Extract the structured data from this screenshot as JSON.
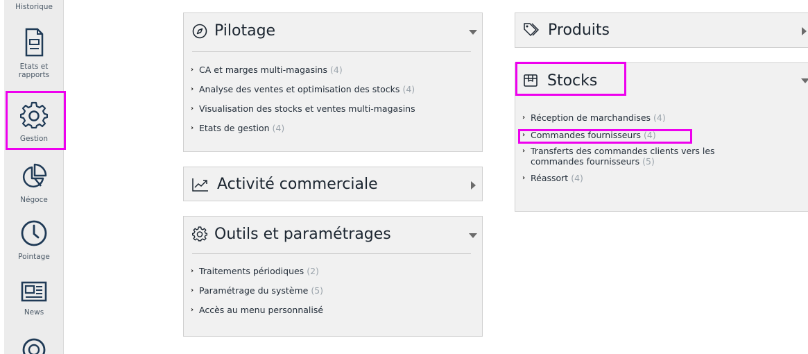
{
  "sidebar": {
    "items": [
      {
        "label": "Historique"
      },
      {
        "label": "Etats et\nrapports"
      },
      {
        "label": "Gestion"
      },
      {
        "label": "Négoce"
      },
      {
        "label": "Pointage"
      },
      {
        "label": "News"
      }
    ]
  },
  "panels": {
    "pilotage": {
      "title": "Pilotage",
      "items": [
        {
          "label": "CA et marges multi-magasins",
          "count": "(4)"
        },
        {
          "label": "Analyse des ventes et optimisation des stocks",
          "count": "(4)"
        },
        {
          "label": "Visualisation des stocks et ventes multi-magasins",
          "count": ""
        },
        {
          "label": "Etats de gestion",
          "count": "(4)"
        }
      ]
    },
    "activite": {
      "title": "Activité commerciale"
    },
    "outils": {
      "title": "Outils et paramétrages",
      "items": [
        {
          "label": "Traitements périodiques",
          "count": "(2)"
        },
        {
          "label": "Paramétrage du système",
          "count": "(5)"
        },
        {
          "label": "Accès au menu personnalisé",
          "count": ""
        }
      ]
    },
    "produits": {
      "title": "Produits"
    },
    "stocks": {
      "title": "Stocks",
      "items": [
        {
          "label": "Réception de marchandises",
          "count": "(4)"
        },
        {
          "label": "Commandes fournisseurs",
          "count": "(4)"
        },
        {
          "label": "Transferts des commandes clients vers les commandes fournisseurs",
          "count": "(5)"
        },
        {
          "label": "Réassort",
          "count": "(4)"
        }
      ]
    }
  },
  "colors": {
    "highlight": "#ee00ee",
    "panel_bg": "#f1f1f1",
    "sidebar_bg": "#ececec",
    "count_text": "#9aa3ab"
  }
}
